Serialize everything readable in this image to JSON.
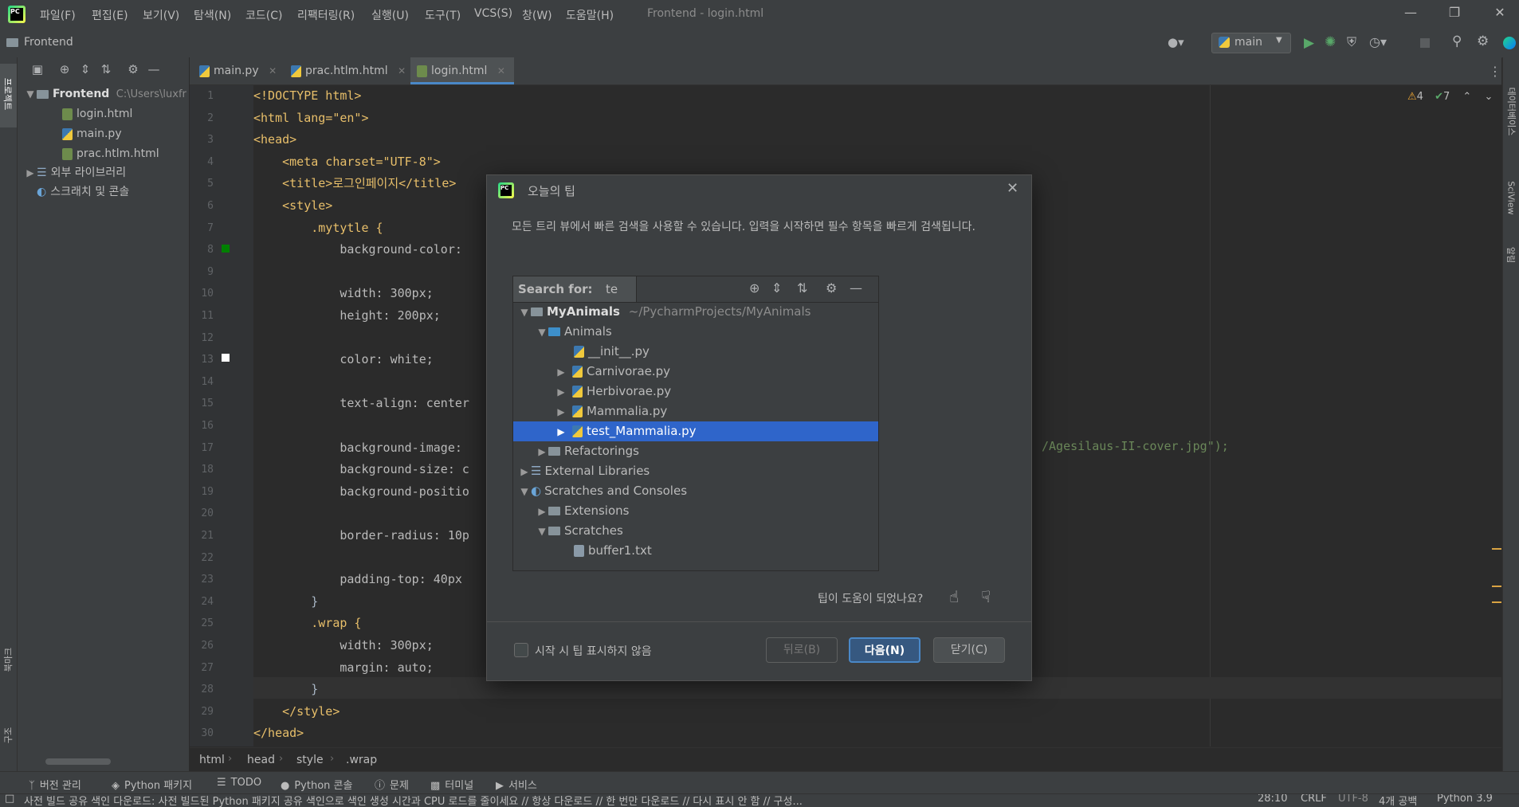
{
  "app": {
    "window_title": "Frontend - login.html",
    "menu": [
      "파일(F)",
      "편집(E)",
      "보기(V)",
      "탐색(N)",
      "코드(C)",
      "리팩터링(R)",
      "실행(U)",
      "도구(T)",
      "VCS(S)",
      "창(W)",
      "도움말(H)"
    ]
  },
  "navbar": {
    "project": "Frontend",
    "branch": "main"
  },
  "left_stripe": {
    "project_label": "프로젝트",
    "bookmarks_label": "북마크",
    "structure_label": "구조"
  },
  "right_stripe": {
    "database_label": "데이터베이스",
    "sciview_label": "SciView",
    "notifications_label": "알림"
  },
  "project_tree": {
    "root": {
      "name": "Frontend",
      "path": "C:\\Users\\luxfr"
    },
    "files": [
      "login.html",
      "main.py",
      "prac.htlm.html"
    ],
    "external_libraries": "외부 라이브러리",
    "scratches": "스크래치 및 콘솔"
  },
  "tabs": [
    "main.py",
    "prac.htlm.html",
    "login.html"
  ],
  "inspections": {
    "warnings": "4",
    "ok": "7"
  },
  "editor": {
    "line_numbers": [
      "1",
      "2",
      "3",
      "4",
      "5",
      "6",
      "7",
      "8",
      "9",
      "10",
      "11",
      "12",
      "13",
      "14",
      "15",
      "16",
      "17",
      "18",
      "19",
      "20",
      "21",
      "22",
      "23",
      "24",
      "25",
      "26",
      "27",
      "28",
      "29",
      "30"
    ],
    "lines": [
      "<!DOCTYPE html>",
      "<html lang=\"en\">",
      "<head>",
      "    <meta charset=\"UTF-8\">",
      "    <title>로그인페이지</title>",
      "    <style>",
      "        .mytytle {",
      "            background-color:",
      "",
      "            width: 300px;",
      "            height: 200px;",
      "",
      "            color: white;",
      "",
      "            text-align: center",
      "",
      "            background-image:",
      "            background-size: c",
      "            background-positio",
      "",
      "            border-radius: 10p",
      "",
      "            padding-top: 40px",
      "        }",
      "        .wrap {",
      "            width: 300px;",
      "            margin: auto;",
      "        }",
      "    </style>",
      "</head>"
    ],
    "line17_tail": "/Agesilaus-II-cover.jpg\");"
  },
  "breadcrumb": [
    "html",
    "head",
    "style",
    ".wrap"
  ],
  "bottom_tools": [
    "버전 관리",
    "Python 패키지",
    "TODO",
    "Python 콘솔",
    "문제",
    "터미널",
    "서비스"
  ],
  "status": {
    "message": "사전 빌드 공유 색인 다운로드: 사전 빌드된 Python 패키지 공유 색인으로 색인 생성 시간과 CPU 로드를 줄이세요 // 항상 다운로드 // 한 번만 다운로드 // 다시 표시 안 함 // 구성...",
    "position": "28:10",
    "line_ending": "CRLF",
    "encoding": "UTF-8",
    "indent": "4개 공백",
    "interpreter": "Python 3.9"
  },
  "dialog": {
    "title": "오늘의 팁",
    "tip_text": "모든 트리 뷰에서 빠른 검색을 사용할 수 있습니다. 입력을 시작하면 필수 항목을 빠르게 검색됩니다.",
    "search_label": "Search for:",
    "search_value": "te",
    "tree": [
      {
        "name": "MyAnimals",
        "extra": "~/PycharmProjects/MyAnimals"
      },
      {
        "name": "Animals"
      },
      {
        "name": "__init__.py"
      },
      {
        "name": "Carnivorae.py"
      },
      {
        "name": "Herbivorae.py"
      },
      {
        "name": "Mammalia.py"
      },
      {
        "name": "test_Mammalia.py"
      },
      {
        "name": "Refactorings"
      },
      {
        "name": "External Libraries"
      },
      {
        "name": "Scratches and Consoles"
      },
      {
        "name": "Extensions"
      },
      {
        "name": "Scratches"
      },
      {
        "name": "buffer1.txt"
      }
    ],
    "feedback_question": "팁이 도움이 되었나요?",
    "dont_show_label": "시작 시 팁 표시하지 않음",
    "back_label": "뒤로(B)",
    "next_label": "다음(N)",
    "close_label": "닫기(C)"
  },
  "colors": {
    "accent": "#4a88c7",
    "selection": "#2f65ca",
    "background": "#2b2b2b",
    "panel": "#3c3f41"
  }
}
